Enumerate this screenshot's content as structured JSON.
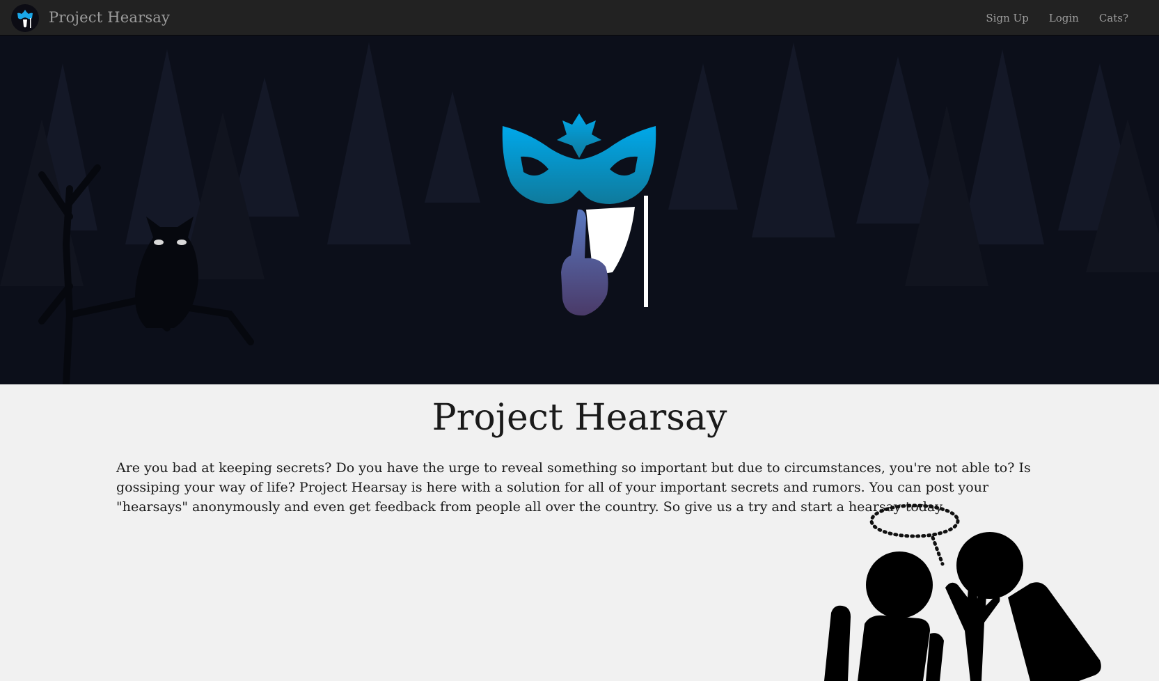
{
  "navbar": {
    "brand": "Project Hearsay",
    "links": [
      {
        "label": "Sign Up"
      },
      {
        "label": "Login"
      },
      {
        "label": "Cats?"
      }
    ],
    "background": "#222222",
    "link_color": "#9d9d9d"
  },
  "hero": {
    "background": "#0c0f1a",
    "logo_icon": "masquerade-mask-shush-icon",
    "owl_icon": "owl-silhouette-icon",
    "mask_color_top": "#00a0e6",
    "mask_color_bottom": "#0f7a9c",
    "hand_color": "#5a6aa8"
  },
  "main": {
    "title": "Project Hearsay",
    "intro": "Are you bad at keeping secrets? Do you have the urge to reveal something so important but due to circumstances, you're not able to? Is gossiping your way of life? Project Hearsay is here with a solution for all of your important secrets and rumors. You can post your \"hearsays\" anonymously and even get feedback from people all over the country. So give us a try and start a hearsay today.",
    "illustration_icon": "whispering-people-icon"
  }
}
